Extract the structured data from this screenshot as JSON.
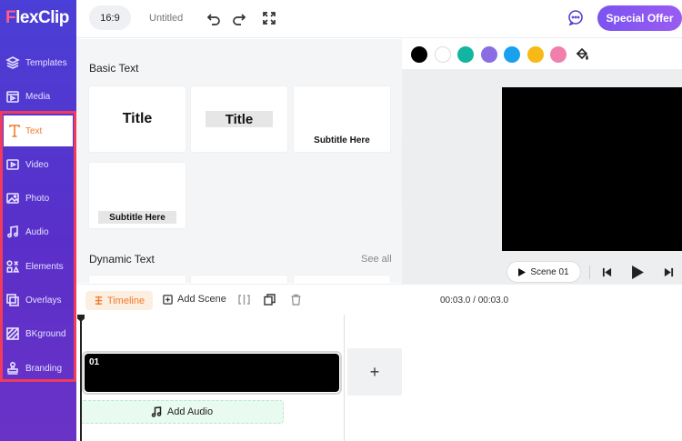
{
  "app": {
    "logo_letter": "F",
    "logo_rest": "lexClip"
  },
  "sidebar": {
    "items": [
      {
        "label": "Templates",
        "icon": "layers-icon"
      },
      {
        "label": "Media",
        "icon": "media-icon"
      },
      {
        "label": "Text",
        "icon": "text-icon",
        "active": true
      },
      {
        "label": "Video",
        "icon": "video-icon"
      },
      {
        "label": "Photo",
        "icon": "photo-icon"
      },
      {
        "label": "Audio",
        "icon": "music-icon"
      },
      {
        "label": "Elements",
        "icon": "elements-icon"
      },
      {
        "label": "Overlays",
        "icon": "overlays-icon"
      },
      {
        "label": "BKground",
        "icon": "background-icon"
      },
      {
        "label": "Branding",
        "icon": "stamp-icon"
      }
    ]
  },
  "topbar": {
    "ratio": "16:9",
    "title": "Untitled",
    "offer_label": "Special Offer"
  },
  "panel": {
    "basic_title": "Basic Text",
    "card_title_1": "Title",
    "card_title_2": "Title",
    "card_subtitle_1": "Subtitle Here",
    "card_subtitle_2": "Subtitle Here",
    "dynamic_title": "Dynamic Text",
    "see_all": "See all"
  },
  "colors": {
    "swatches": [
      "#000000",
      "#ffffff",
      "#12b5a0",
      "#8a6de3",
      "#1aa0ef",
      "#f7b916",
      "#f07fae"
    ],
    "accent": "#f07b2b",
    "brand": "#5a3fd0"
  },
  "preview": {
    "scene_label": "Scene 01"
  },
  "timeline": {
    "tab_label": "Timeline",
    "add_scene_label": "Add Scene",
    "time": "00:03.0 / 00:03.0",
    "clip_number": "01",
    "add_box_label": "+",
    "add_audio_label": "Add Audio"
  }
}
